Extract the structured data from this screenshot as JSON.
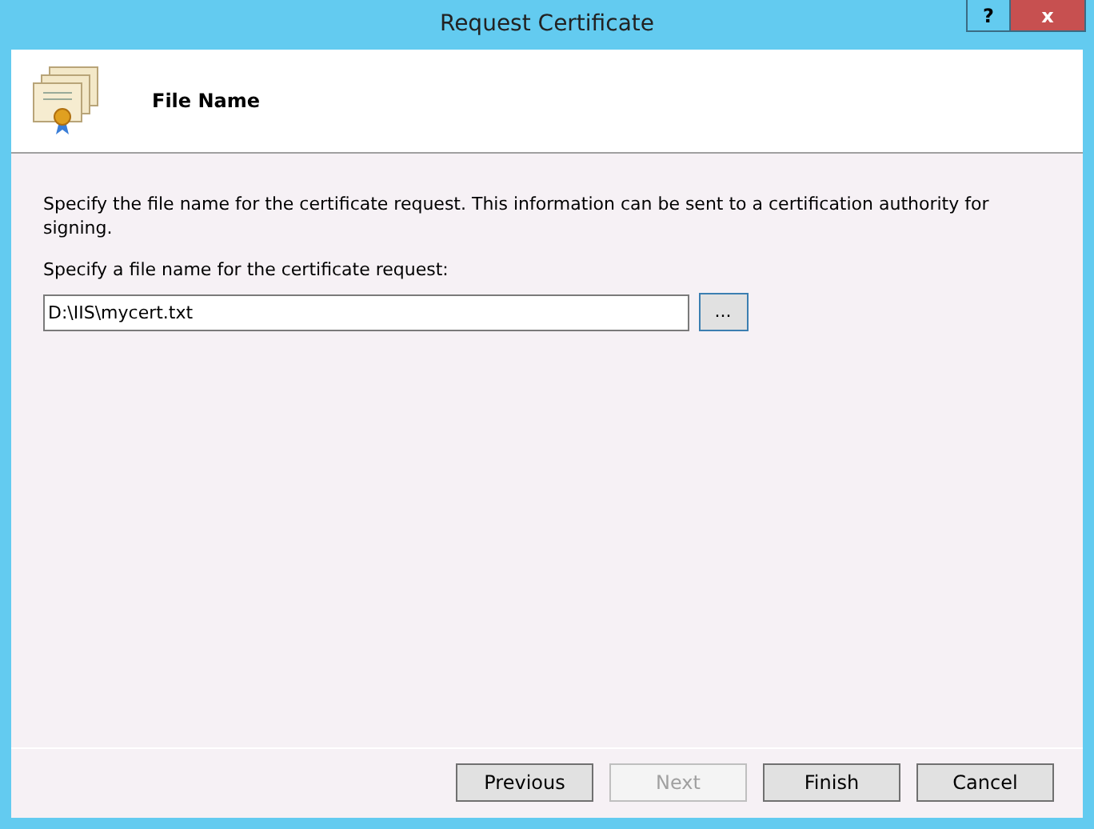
{
  "window": {
    "title": "Request Certificate",
    "help_button": "?",
    "close_button": "x"
  },
  "header": {
    "title": "File Name"
  },
  "description": "Specify the file name for the certificate request. This information can be sent to a certification authority for signing.",
  "field": {
    "label": "Specify a file name for the certificate request:",
    "value": "D:\\IIS\\mycert.txt",
    "browse_button": "..."
  },
  "buttons": [
    {
      "label": "Previous",
      "disabled": false
    },
    {
      "label": "Next",
      "disabled": true
    },
    {
      "label": "Finish",
      "disabled": false
    },
    {
      "label": "Cancel",
      "disabled": false
    }
  ]
}
